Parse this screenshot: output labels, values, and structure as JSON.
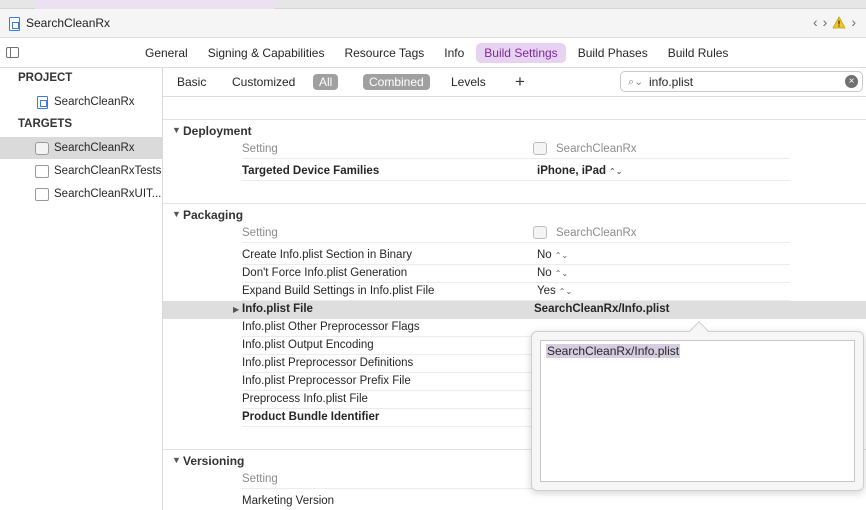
{
  "window": {
    "file_title": "SearchCleanRx"
  },
  "editor_tabs": [
    {
      "label": "General",
      "active": false
    },
    {
      "label": "Signing & Capabilities",
      "active": false
    },
    {
      "label": "Resource Tags",
      "active": false
    },
    {
      "label": "Info",
      "active": false
    },
    {
      "label": "Build Settings",
      "active": true
    },
    {
      "label": "Build Phases",
      "active": false
    },
    {
      "label": "Build Rules",
      "active": false
    }
  ],
  "navigator": {
    "project_header": "PROJECT",
    "project": "SearchCleanRx",
    "targets_header": "TARGETS",
    "targets": [
      "SearchCleanRx",
      "SearchCleanRxTests",
      "SearchCleanRxUIT..."
    ]
  },
  "filter": {
    "basic": "Basic",
    "customized": "Customized",
    "all": "All",
    "combined": "Combined",
    "levels": "Levels",
    "add": "+",
    "search_value": "info.plist"
  },
  "groups": {
    "deployment": {
      "name": "Deployment",
      "header_setting": "Setting",
      "header_target": "SearchCleanRx",
      "rows": [
        {
          "label": "Targeted Device Families",
          "value": "iPhone, iPad"
        }
      ]
    },
    "packaging": {
      "name": "Packaging",
      "header_setting": "Setting",
      "header_target": "SearchCleanRx",
      "rows": [
        {
          "label": "Create Info.plist Section in Binary",
          "value": "No"
        },
        {
          "label": "Don't Force Info.plist Generation",
          "value": "No"
        },
        {
          "label": "Expand Build Settings in Info.plist File",
          "value": "Yes"
        },
        {
          "label": "Info.plist File",
          "value": "SearchCleanRx/Info.plist"
        },
        {
          "label": "Info.plist Other Preprocessor Flags",
          "value": ""
        },
        {
          "label": "Info.plist Output Encoding",
          "value": ""
        },
        {
          "label": "Info.plist Preprocessor Definitions",
          "value": ""
        },
        {
          "label": "Info.plist Preprocessor Prefix File",
          "value": ""
        },
        {
          "label": "Preprocess Info.plist File",
          "value": ""
        },
        {
          "label": "Product Bundle Identifier",
          "value": ""
        }
      ]
    },
    "versioning": {
      "name": "Versioning",
      "header_setting": "Setting",
      "rows": [
        {
          "label": "Marketing Version"
        }
      ]
    }
  },
  "popover": {
    "text": "SearchCleanRx/Info.plist"
  },
  "colors": {
    "accent_tab_bg": "#e8d2f1",
    "accent_tab_text": "#7b2a99",
    "selection": "#dedede"
  }
}
